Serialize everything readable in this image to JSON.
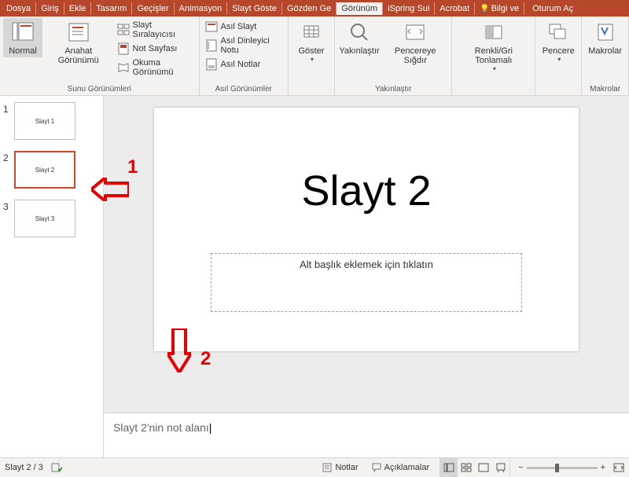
{
  "tabs": {
    "file": "Dosya",
    "t1": "Giriş",
    "t2": "Ekle",
    "t3": "Tasarım",
    "t4": "Geçişler",
    "t5": "Animasyon",
    "t6": "Slayt Göste",
    "t7": "Gözden Ge",
    "t8": "Görünüm",
    "t9": "iSpring Sui",
    "t10": "Acrobat",
    "tell": "Bilgi ve",
    "signin": "Oturum Aç"
  },
  "ribbon": {
    "g1": {
      "label": "Sunu Görünümleri",
      "normal": "Normal",
      "outline": "Anahat Görünümü",
      "sorter": "Slayt Sıralayıcısı",
      "notespg": "Not Sayfası",
      "reading": "Okuma Görünümü"
    },
    "g2": {
      "label": "Asıl Görünümler",
      "slidemaster": "Asıl Slayt",
      "handout": "Asıl Dinleyici Notu",
      "notesmaster": "Asıl Notlar"
    },
    "g3": {
      "show": "Göster"
    },
    "g4": {
      "label": "Yakınlaştır",
      "zoom": "Yakınlaştır",
      "fit": "Pencereye Sığdır"
    },
    "g5": {
      "gray": "Renkli/Gri Tonlamalı"
    },
    "g6": {
      "window": "Pencere"
    },
    "g7": {
      "label": "Makrolar",
      "macros": "Makrolar"
    }
  },
  "thumbs": {
    "n1": "1",
    "s1": "Slayt 1",
    "n2": "2",
    "s2": "Slayt 2",
    "n3": "3",
    "s3": "Slayt 3"
  },
  "slide": {
    "title": "Slayt 2",
    "subtitle_placeholder": "Alt başlık eklemek için tıklatın"
  },
  "notes": {
    "text": "Slayt 2'nin not alanı"
  },
  "status": {
    "counter": "Slayt 2 / 3",
    "notes_btn": "Notlar",
    "comments_btn": "Açıklamalar"
  },
  "anno": {
    "n1": "1",
    "n2": "2"
  }
}
